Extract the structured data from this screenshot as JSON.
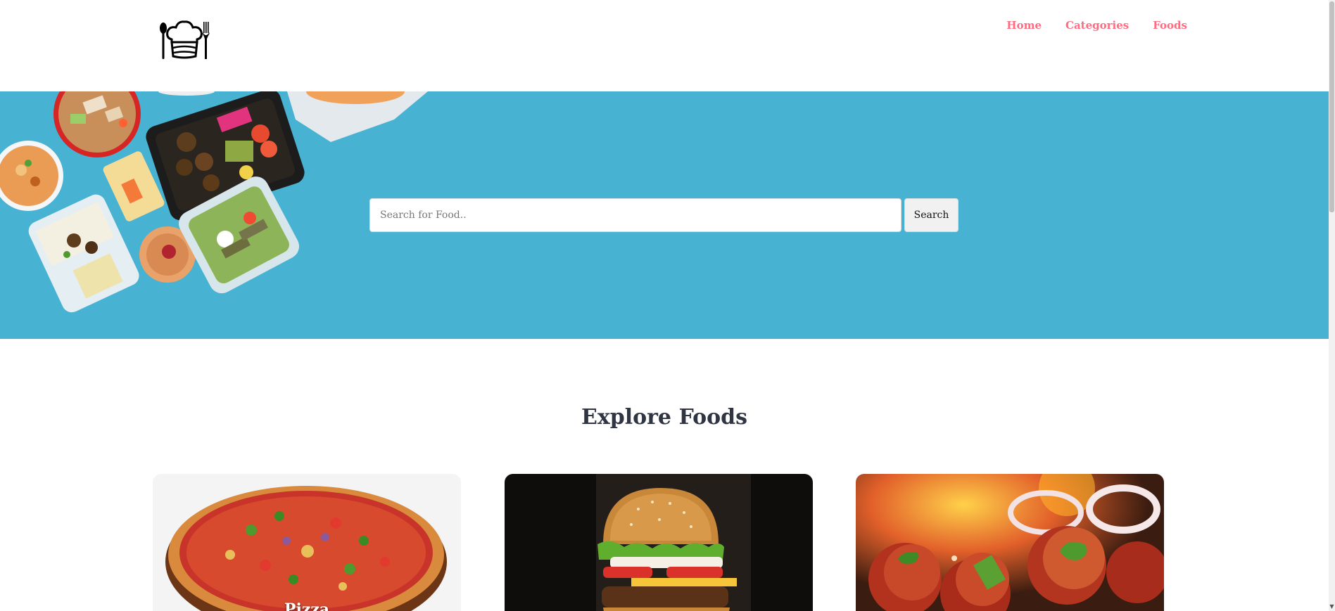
{
  "nav": {
    "items": [
      {
        "label": "Home"
      },
      {
        "label": "Categories"
      },
      {
        "label": "Foods"
      }
    ]
  },
  "logo": {
    "icon": "chef-hat-spoon-fork-icon"
  },
  "search": {
    "placeholder": "Search for Food..",
    "value": "",
    "button_label": "Search"
  },
  "explore": {
    "title": "Explore Foods",
    "cards": [
      {
        "title": "Pizza",
        "image": "pizza-image"
      },
      {
        "title": "",
        "image": "burger-image"
      },
      {
        "title": "",
        "image": "tandoori-chicken-image"
      }
    ]
  },
  "colors": {
    "nav_link": "#ff6b81",
    "hero_background": "#48b2d3",
    "heading": "#2f3542"
  }
}
